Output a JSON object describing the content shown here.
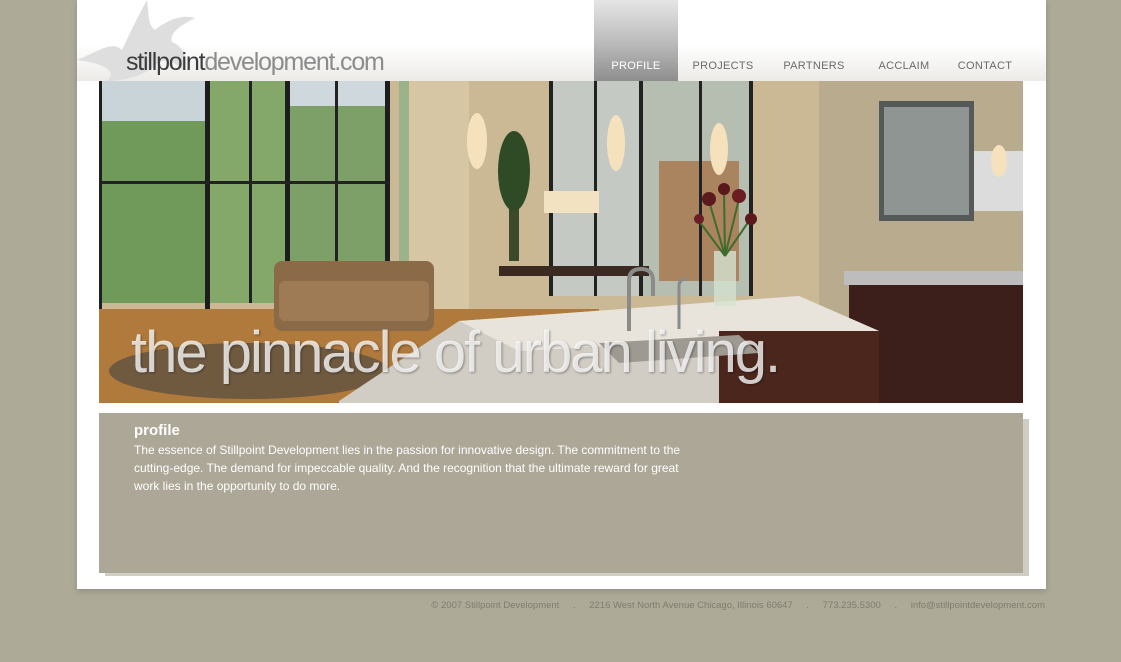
{
  "logo": {
    "part1": "stillpoint",
    "part2": "development.com"
  },
  "nav": {
    "items": [
      {
        "label": "PROFILE",
        "active": true
      },
      {
        "label": "PROJECTS",
        "active": false
      },
      {
        "label": "PARTNERS",
        "active": false
      },
      {
        "label": "ACCLAIM",
        "active": false
      },
      {
        "label": "CONTACT",
        "active": false
      }
    ]
  },
  "hero": {
    "tagline": "the pinnacle of urban living."
  },
  "content": {
    "title": "profile",
    "text": "The essence of Stillpoint Development lies in the passion for innovative design. The commitment to the cutting-edge. The demand for impeccable quality. And the recognition that the ultimate reward for great work lies in the opportunity to do more."
  },
  "footer": {
    "copyright": "© 2007 Stillpoint Development",
    "address": "2216 West North Avenue Chicago, Illinois 60647",
    "phone": "773.235.5300",
    "email": "info@stillpointdevelopment.com"
  },
  "colors": {
    "background": "#aeaa98",
    "content_panel": "#aca797",
    "nav_active": "#9a9a9a"
  }
}
